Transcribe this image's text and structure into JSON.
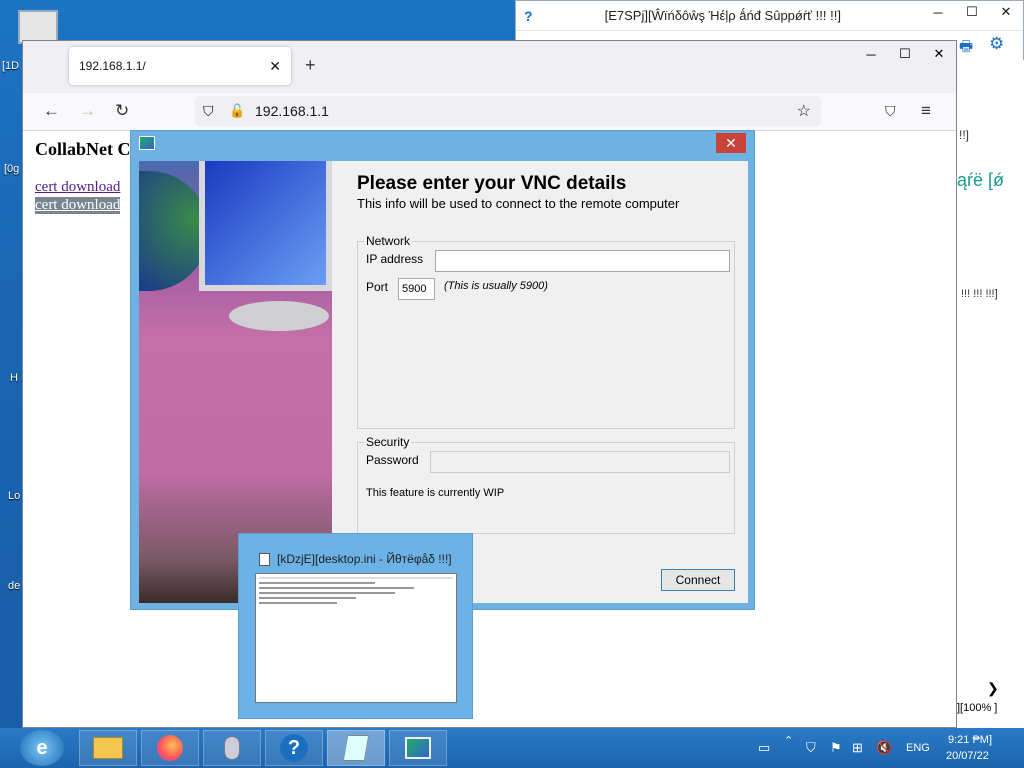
{
  "desktop": {
    "icons": [
      "[1D",
      "[0g",
      "H",
      "Lo",
      "de"
    ]
  },
  "help_window": {
    "title": "[E7SPj][Ŵïńδôŵş Ήέļρ ǻńđ Sûppǿŕť !!! !!]",
    "frag1": "!!]",
    "frag2": "ąŕë [ǿ",
    "frag3": "!!! !!! !!!]",
    "zoom": "][100% ]"
  },
  "browser": {
    "tab_title": "192.168.1.1/",
    "url": "192.168.1.1",
    "page_heading": "CollabNet C",
    "links": [
      "cert download",
      "cert download"
    ]
  },
  "vnc": {
    "heading": "Please enter your VNC details",
    "subheading": "This info will be used to connect to the remote computer",
    "network_group": "Network",
    "ip_label": "IP address",
    "ip_value": "",
    "port_label": "Port",
    "port_value": "5900",
    "port_hint": "(This is usually 5900)",
    "security_group": "Security",
    "password_label": "Password",
    "wip_note": "This feature is currently WIP",
    "connect": "Connect"
  },
  "preview": {
    "title": "[kDzjE][desktop.ini - Йθтёφåδ !!!]"
  },
  "tray": {
    "lang": "ENG",
    "time": "9:21 ₱M]",
    "date": "20/07/22"
  }
}
